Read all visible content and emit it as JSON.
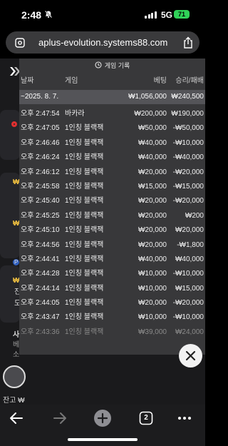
{
  "status_bar": {
    "time": "2:48",
    "network": "5G",
    "battery": "71"
  },
  "browser": {
    "url": "aplus-evolution.systems88.com",
    "tab_count": "2"
  },
  "background_page": {
    "fragments": [
      "₩",
      "₩",
      "P",
      "₩",
      "진",
      "도",
      "사",
      "베",
      "소"
    ],
    "balance_label": "잔고 ₩"
  },
  "history": {
    "title": "게임 기록",
    "columns": {
      "date": "날짜",
      "game": "게임",
      "bet": "베팅",
      "win_loss": "승리/패배"
    },
    "summary": {
      "date": "~2025. 8. 7.",
      "bet": "₩1,056,000",
      "win_loss": "₩240,500"
    },
    "rows": [
      {
        "time": "오후 2:47:54",
        "game": "바카라",
        "bet": "₩200,000",
        "result": "₩190,000"
      },
      {
        "time": "오후 2:47:05",
        "game": "1인칭 블랙잭",
        "bet": "₩50,000",
        "result": "-₩50,000"
      },
      {
        "time": "오후 2:46:46",
        "game": "1인칭 블랙잭",
        "bet": "₩40,000",
        "result": "-₩10,000"
      },
      {
        "time": "오후 2:46:24",
        "game": "1인칭 블랙잭",
        "bet": "₩40,000",
        "result": "-₩40,000"
      },
      {
        "time": "오후 2:46:12",
        "game": "1인칭 블랙잭",
        "bet": "₩20,000",
        "result": "-₩20,000"
      },
      {
        "time": "오후 2:45:58",
        "game": "1인칭 블랙잭",
        "bet": "₩15,000",
        "result": "-₩15,000"
      },
      {
        "time": "오후 2:45:40",
        "game": "1인칭 블랙잭",
        "bet": "₩20,000",
        "result": "-₩20,000"
      },
      {
        "time": "오후 2:45:25",
        "game": "1인칭 블랙잭",
        "bet": "₩20,000",
        "result": "₩200"
      },
      {
        "time": "오후 2:45:10",
        "game": "1인칭 블랙잭",
        "bet": "₩20,000",
        "result": "₩20,000"
      },
      {
        "time": "오후 2:44:56",
        "game": "1인칭 블랙잭",
        "bet": "₩20,000",
        "result": "-₩1,800"
      },
      {
        "time": "오후 2:44:41",
        "game": "1인칭 블랙잭",
        "bet": "₩40,000",
        "result": "₩40,000"
      },
      {
        "time": "오후 2:44:28",
        "game": "1인칭 블랙잭",
        "bet": "₩10,000",
        "result": "-₩10,000"
      },
      {
        "time": "오후 2:44:14",
        "game": "1인칭 블랙잭",
        "bet": "₩10,000",
        "result": "₩15,000"
      },
      {
        "time": "오후 2:44:05",
        "game": "1인칭 블랙잭",
        "bet": "₩20,000",
        "result": "-₩20,000"
      },
      {
        "time": "오후 2:43:47",
        "game": "1인칭 블랙잭",
        "bet": "₩10,000",
        "result": "-₩10,000"
      },
      {
        "time": "오후 2:43:36",
        "game": "1인칭 블랙잭",
        "bet": "₩39,000",
        "result": "₩24,000"
      }
    ]
  },
  "colors": {
    "panel_bg": "#3a3a3c",
    "summary_bg": "#545458",
    "battery": "#30d158",
    "chip_gold": "#f0c040"
  },
  "icons": {
    "history": "clock-history-icon",
    "close": "close-icon",
    "back": "arrow-left-icon",
    "forward": "arrow-right-icon",
    "new_tab": "plus-icon",
    "tabs": "tabs-icon",
    "more": "more-icon",
    "share": "share-icon",
    "site_settings": "site-settings-icon",
    "silent": "bell-slash-icon"
  }
}
